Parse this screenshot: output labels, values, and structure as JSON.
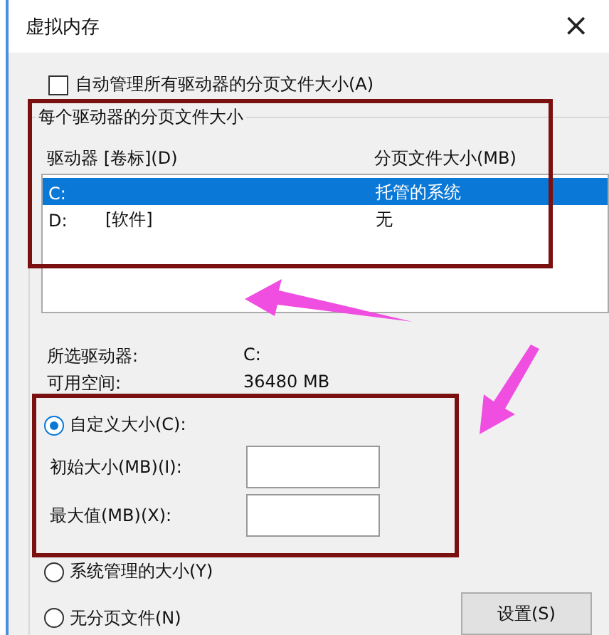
{
  "window": {
    "title": "虚拟内存",
    "close": "×"
  },
  "auto_manage": {
    "label": "自动管理所有驱动器的分页文件大小(A)",
    "checked": false
  },
  "group": {
    "title": "每个驱动器的分页文件大小",
    "columns": [
      "驱动器 [卷标](D)",
      "分页文件大小(MB)"
    ],
    "rows": [
      {
        "drive": "C:",
        "label": "",
        "size": "托管的系统",
        "selected": true
      },
      {
        "drive": "D:",
        "label": "[软件]",
        "size": "无",
        "selected": false
      }
    ],
    "info": [
      {
        "label": "所选驱动器:",
        "value": "C:"
      },
      {
        "label": "可用空间:",
        "value": "36480 MB"
      }
    ],
    "options": [
      {
        "kind": "custom",
        "label": "自定义大小(C):",
        "selected": true,
        "fields": [
          {
            "label": "初始大小(MB)(I):"
          },
          {
            "label": "最大值(MB)(X):"
          }
        ]
      },
      {
        "kind": "plain",
        "label": "系统管理的大小(Y)",
        "selected": false
      },
      {
        "kind": "plain",
        "label": "无分页文件(N)",
        "selected": false
      }
    ],
    "set_button": "设置(S)"
  }
}
